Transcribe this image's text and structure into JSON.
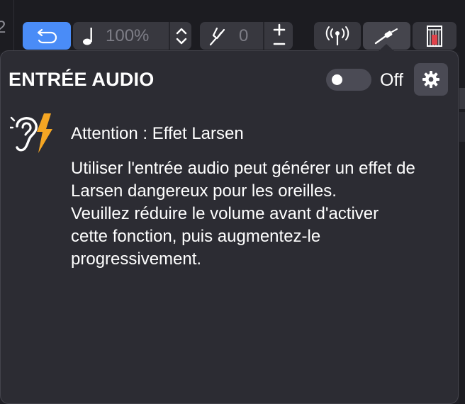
{
  "toolbar": {
    "edge_number": "2",
    "tempo": {
      "value": "100%"
    },
    "tuning": {
      "value": "0"
    },
    "icons": {
      "loop": "loop-back-icon",
      "tempo": "music-note-icon",
      "tempo_stepper": "chevron-up-down-icon",
      "tuning": "tuning-fork-icon",
      "tuning_stepper": "plus-minus-icon",
      "antenna": "broadcast-antenna-icon",
      "cable": "audio-cable-icon",
      "meter": "level-meter-icon"
    }
  },
  "popover": {
    "title": "ENTRÉE AUDIO",
    "toggle": {
      "state": "Off",
      "on": false
    },
    "settings_icon": "gear-icon",
    "warning": {
      "icon": "ear-lightning-icon",
      "title": "Attention : Effet Larsen",
      "lines": [
        "Utiliser l'entrée audio peut générer un effet de",
        "Larsen dangereux pour les oreilles.",
        "Veuillez réduire le volume avant d'activer",
        "cette fonction, puis augmentez-le",
        "progressivement."
      ]
    }
  },
  "colors": {
    "accent": "#4a8cf7",
    "warning_bolt": "#f5a623",
    "popover_bg": "#2c2c33",
    "toolbar_button": "#38383f"
  }
}
